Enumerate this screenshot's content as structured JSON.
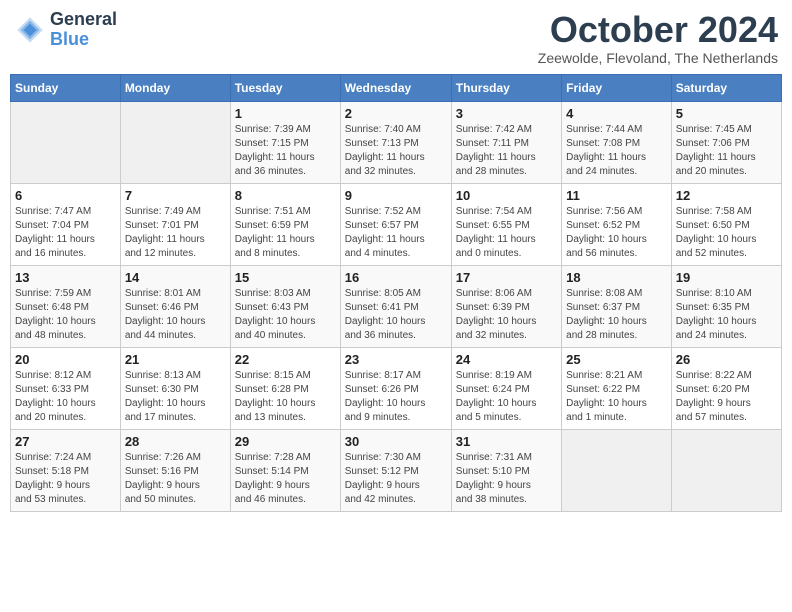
{
  "logo": {
    "line1": "General",
    "line2": "Blue"
  },
  "title": "October 2024",
  "location": "Zeewolde, Flevoland, The Netherlands",
  "days_of_week": [
    "Sunday",
    "Monday",
    "Tuesday",
    "Wednesday",
    "Thursday",
    "Friday",
    "Saturday"
  ],
  "weeks": [
    [
      {
        "day": "",
        "info": ""
      },
      {
        "day": "",
        "info": ""
      },
      {
        "day": "1",
        "info": "Sunrise: 7:39 AM\nSunset: 7:15 PM\nDaylight: 11 hours\nand 36 minutes."
      },
      {
        "day": "2",
        "info": "Sunrise: 7:40 AM\nSunset: 7:13 PM\nDaylight: 11 hours\nand 32 minutes."
      },
      {
        "day": "3",
        "info": "Sunrise: 7:42 AM\nSunset: 7:11 PM\nDaylight: 11 hours\nand 28 minutes."
      },
      {
        "day": "4",
        "info": "Sunrise: 7:44 AM\nSunset: 7:08 PM\nDaylight: 11 hours\nand 24 minutes."
      },
      {
        "day": "5",
        "info": "Sunrise: 7:45 AM\nSunset: 7:06 PM\nDaylight: 11 hours\nand 20 minutes."
      }
    ],
    [
      {
        "day": "6",
        "info": "Sunrise: 7:47 AM\nSunset: 7:04 PM\nDaylight: 11 hours\nand 16 minutes."
      },
      {
        "day": "7",
        "info": "Sunrise: 7:49 AM\nSunset: 7:01 PM\nDaylight: 11 hours\nand 12 minutes."
      },
      {
        "day": "8",
        "info": "Sunrise: 7:51 AM\nSunset: 6:59 PM\nDaylight: 11 hours\nand 8 minutes."
      },
      {
        "day": "9",
        "info": "Sunrise: 7:52 AM\nSunset: 6:57 PM\nDaylight: 11 hours\nand 4 minutes."
      },
      {
        "day": "10",
        "info": "Sunrise: 7:54 AM\nSunset: 6:55 PM\nDaylight: 11 hours\nand 0 minutes."
      },
      {
        "day": "11",
        "info": "Sunrise: 7:56 AM\nSunset: 6:52 PM\nDaylight: 10 hours\nand 56 minutes."
      },
      {
        "day": "12",
        "info": "Sunrise: 7:58 AM\nSunset: 6:50 PM\nDaylight: 10 hours\nand 52 minutes."
      }
    ],
    [
      {
        "day": "13",
        "info": "Sunrise: 7:59 AM\nSunset: 6:48 PM\nDaylight: 10 hours\nand 48 minutes."
      },
      {
        "day": "14",
        "info": "Sunrise: 8:01 AM\nSunset: 6:46 PM\nDaylight: 10 hours\nand 44 minutes."
      },
      {
        "day": "15",
        "info": "Sunrise: 8:03 AM\nSunset: 6:43 PM\nDaylight: 10 hours\nand 40 minutes."
      },
      {
        "day": "16",
        "info": "Sunrise: 8:05 AM\nSunset: 6:41 PM\nDaylight: 10 hours\nand 36 minutes."
      },
      {
        "day": "17",
        "info": "Sunrise: 8:06 AM\nSunset: 6:39 PM\nDaylight: 10 hours\nand 32 minutes."
      },
      {
        "day": "18",
        "info": "Sunrise: 8:08 AM\nSunset: 6:37 PM\nDaylight: 10 hours\nand 28 minutes."
      },
      {
        "day": "19",
        "info": "Sunrise: 8:10 AM\nSunset: 6:35 PM\nDaylight: 10 hours\nand 24 minutes."
      }
    ],
    [
      {
        "day": "20",
        "info": "Sunrise: 8:12 AM\nSunset: 6:33 PM\nDaylight: 10 hours\nand 20 minutes."
      },
      {
        "day": "21",
        "info": "Sunrise: 8:13 AM\nSunset: 6:30 PM\nDaylight: 10 hours\nand 17 minutes."
      },
      {
        "day": "22",
        "info": "Sunrise: 8:15 AM\nSunset: 6:28 PM\nDaylight: 10 hours\nand 13 minutes."
      },
      {
        "day": "23",
        "info": "Sunrise: 8:17 AM\nSunset: 6:26 PM\nDaylight: 10 hours\nand 9 minutes."
      },
      {
        "day": "24",
        "info": "Sunrise: 8:19 AM\nSunset: 6:24 PM\nDaylight: 10 hours\nand 5 minutes."
      },
      {
        "day": "25",
        "info": "Sunrise: 8:21 AM\nSunset: 6:22 PM\nDaylight: 10 hours\nand 1 minute."
      },
      {
        "day": "26",
        "info": "Sunrise: 8:22 AM\nSunset: 6:20 PM\nDaylight: 9 hours\nand 57 minutes."
      }
    ],
    [
      {
        "day": "27",
        "info": "Sunrise: 7:24 AM\nSunset: 5:18 PM\nDaylight: 9 hours\nand 53 minutes."
      },
      {
        "day": "28",
        "info": "Sunrise: 7:26 AM\nSunset: 5:16 PM\nDaylight: 9 hours\nand 50 minutes."
      },
      {
        "day": "29",
        "info": "Sunrise: 7:28 AM\nSunset: 5:14 PM\nDaylight: 9 hours\nand 46 minutes."
      },
      {
        "day": "30",
        "info": "Sunrise: 7:30 AM\nSunset: 5:12 PM\nDaylight: 9 hours\nand 42 minutes."
      },
      {
        "day": "31",
        "info": "Sunrise: 7:31 AM\nSunset: 5:10 PM\nDaylight: 9 hours\nand 38 minutes."
      },
      {
        "day": "",
        "info": ""
      },
      {
        "day": "",
        "info": ""
      }
    ]
  ]
}
